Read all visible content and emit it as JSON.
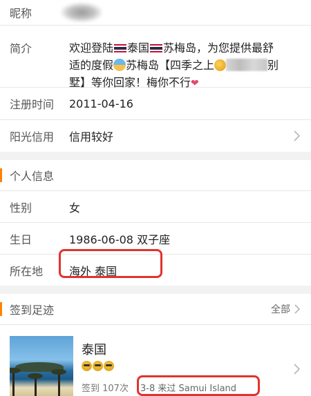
{
  "profile": {
    "nickname_label": "昵称",
    "intro_label": "简介",
    "intro_line1_a": "欢迎登陆",
    "intro_line1_b": "泰国",
    "intro_line1_c": "苏梅岛，为您提供最舒",
    "intro_line2_a": "适的度假",
    "intro_line2_b": "苏梅岛【四季之上",
    "intro_line2_c": "别",
    "intro_line3": "墅】等你回家！梅你不行",
    "reg_label": "注册时间",
    "reg_value": "2011-04-16",
    "credit_label": "阳光信用",
    "credit_value": "信用较好"
  },
  "personal": {
    "title": "个人信息",
    "gender_label": "性别",
    "gender_value": "女",
    "birthday_label": "生日",
    "birthday_value": "1986-06-08 双子座",
    "location_label": "所在地",
    "location_value": "海外 泰国"
  },
  "checkins": {
    "title": "签到足迹",
    "all_label": "全部",
    "place": "泰国",
    "count": "签到 107次",
    "visit": "3-8 来过 Samui Island"
  },
  "colors": {
    "accent": "#ff8200",
    "highlight_box": "#e0332f"
  }
}
